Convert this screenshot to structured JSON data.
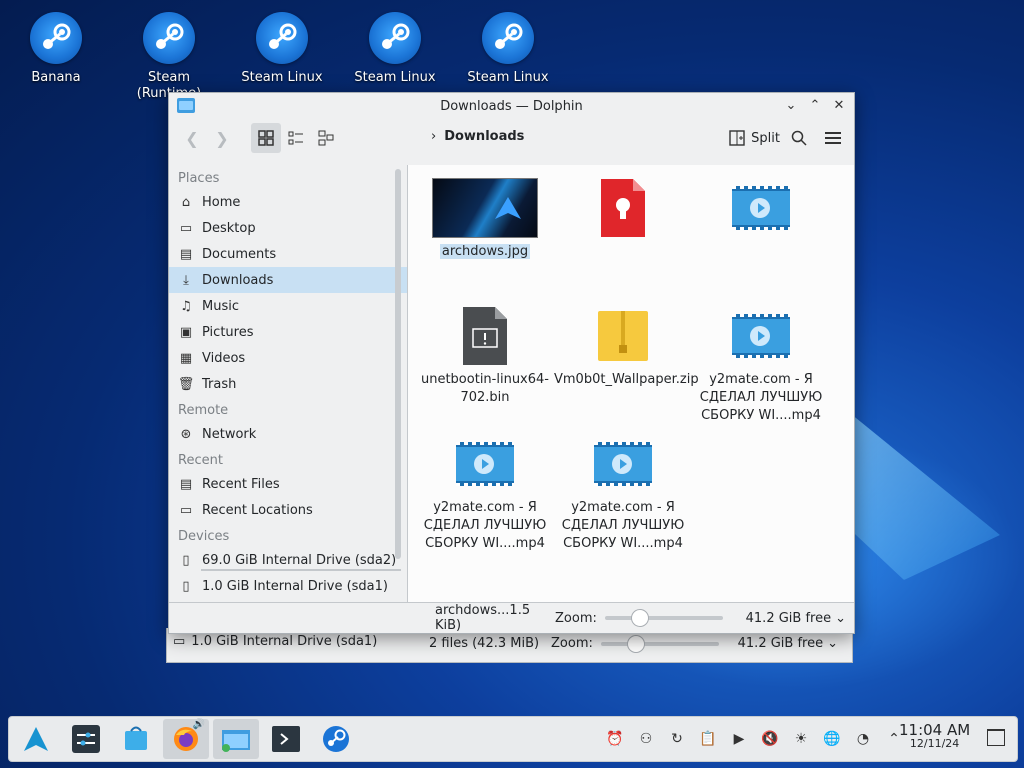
{
  "desktop": {
    "icons": [
      {
        "label": "Banana"
      },
      {
        "label": "Steam (Runtime)"
      },
      {
        "label": "Steam Linux"
      },
      {
        "label": "Steam Linux"
      },
      {
        "label": "Steam Linux"
      }
    ]
  },
  "window": {
    "title": "Downloads — Dolphin",
    "breadcrumb": "Downloads",
    "split_label": "Split"
  },
  "sidebar": {
    "places_header": "Places",
    "places": [
      "Home",
      "Desktop",
      "Documents",
      "Downloads",
      "Music",
      "Pictures",
      "Videos",
      "Trash"
    ],
    "remote_header": "Remote",
    "remote": [
      "Network"
    ],
    "recent_header": "Recent",
    "recent": [
      "Recent Files",
      "Recent Locations"
    ],
    "devices_header": "Devices",
    "devices": [
      "69.0 GiB Internal Drive (sda2)",
      "1.0 GiB Internal Drive (sda1)"
    ]
  },
  "files": [
    {
      "name": "archdows.jpg",
      "icon": "image-thumbnail"
    },
    {
      "name": "",
      "icon": "certificate-icon"
    },
    {
      "name": "",
      "icon": "video-icon"
    },
    {
      "name": "unetbootin-linux64-702.bin",
      "icon": "binary-icon"
    },
    {
      "name": "Vm0b0t_Wallpaper.zip",
      "icon": "zip-icon"
    },
    {
      "name": "y2mate.com - Я СДЕЛАЛ ЛУЧШУЮ СБОРКУ WI....mp4",
      "icon": "video-icon"
    },
    {
      "name": "y2mate.com - Я СДЕЛАЛ ЛУЧШУЮ СБОРКУ WI....mp4",
      "icon": "video-icon"
    },
    {
      "name": "y2mate.com - Я СДЕЛАЛ ЛУЧШУЮ СБОРКУ WI....mp4",
      "icon": "video-icon"
    }
  ],
  "statusbar": {
    "selection": "archdows...1.5 KiB)",
    "zoom_label": "Zoom:",
    "free": "41.2 GiB free"
  },
  "back_window": {
    "device": "1.0 GiB Internal Drive (sda1)",
    "status": "2 files (42.3 MiB)",
    "zoom_label": "Zoom:",
    "free": "41.2 GiB free"
  },
  "taskbar": {
    "time": "11:04 AM",
    "date": "12/11/24"
  },
  "colors": {
    "accent": "#3daee9",
    "selection": "#c8e0f3"
  }
}
